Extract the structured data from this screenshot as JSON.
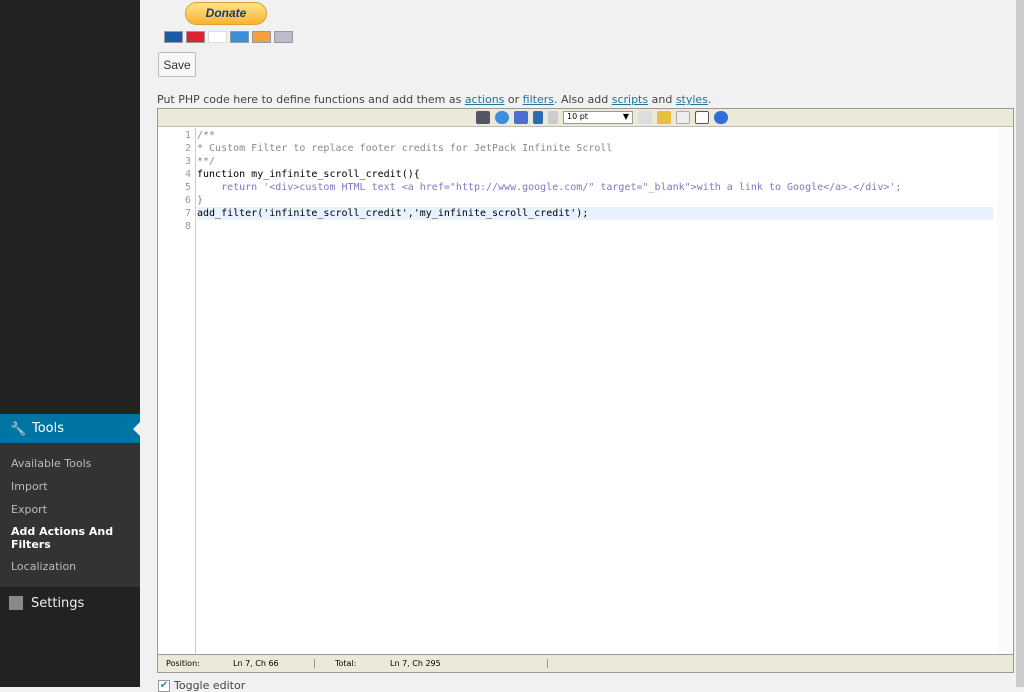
{
  "sidebar": {
    "active": "Tools",
    "submenu": [
      "Available Tools",
      "Import",
      "Export",
      "Add Actions And Filters",
      "Localization"
    ],
    "settings": "Settings",
    "accent": "#0074a2"
  },
  "main": {
    "donate": "Donate",
    "save": "Save",
    "intro": {
      "prefix": "Put PHP code here to define functions and add them as ",
      "actions": "actions",
      "or": " or ",
      "filters": "filters",
      "mid": ". Also add ",
      "scripts": "scripts",
      "and": " and ",
      "styles": "styles",
      "end": "."
    }
  },
  "editor": {
    "font_size": "10 pt",
    "lines": [
      "/**",
      "* Custom Filter to replace footer credits for JetPack Infinite Scroll",
      "**/",
      "function my_infinite_scroll_credit(){",
      "    return '<div>custom HTML text <a href=\"http://www.google.com/\" target=\"_blank\">with a link to Google</a>.</div>';",
      "}",
      "add_filter('infinite_scroll_credit','my_infinite_scroll_credit');",
      ""
    ],
    "status": {
      "position_label": "Position:",
      "position": "Ln 7, Ch 66",
      "total_label": "Total:",
      "total": "Ln 7, Ch 295"
    }
  },
  "toggle_editor": "Toggle editor"
}
